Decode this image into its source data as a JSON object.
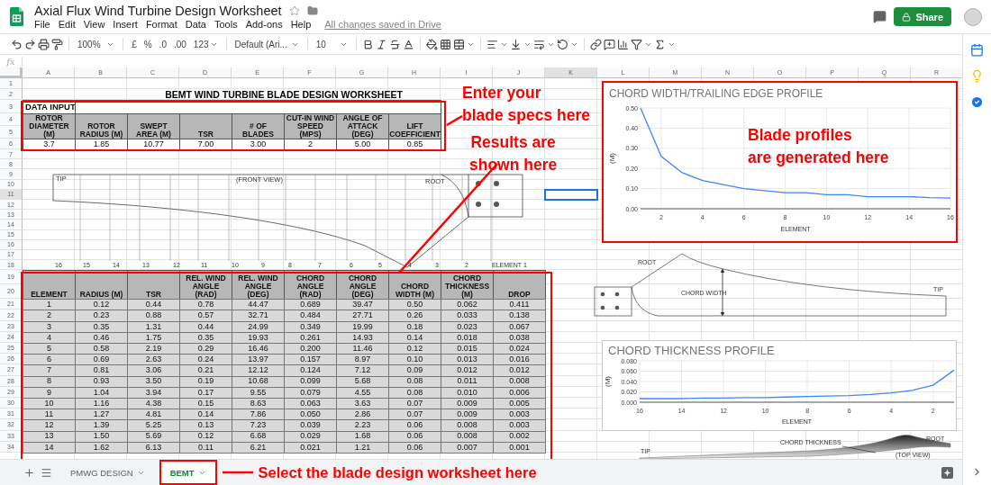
{
  "app": {
    "title": "Axial Flux Wind Turbine Design Worksheet",
    "menu": [
      "File",
      "Edit",
      "View",
      "Insert",
      "Format",
      "Data",
      "Tools",
      "Add-ons",
      "Help"
    ],
    "save_status": "All changes saved in Drive",
    "share": "Share"
  },
  "toolbar": {
    "zoom": "100%",
    "currency": "£",
    "percent": "%",
    "decrease_decimals": ".0",
    "increase_decimals": ".00",
    "number_format": "123",
    "font": "Default (Ari...",
    "font_size": "10"
  },
  "formula_bar": {
    "label": "fx"
  },
  "sheet": {
    "columns": [
      {
        "label": "A",
        "selected": false
      },
      {
        "label": "B",
        "selected": false
      },
      {
        "label": "C",
        "selected": false
      },
      {
        "label": "D",
        "selected": false
      },
      {
        "label": "E",
        "selected": false
      },
      {
        "label": "F",
        "selected": false
      },
      {
        "label": "G",
        "selected": false
      },
      {
        "label": "H",
        "selected": false
      },
      {
        "label": "I",
        "selected": false
      },
      {
        "label": "J",
        "selected": false
      },
      {
        "label": "K",
        "selected": true
      },
      {
        "label": "L",
        "selected": false
      },
      {
        "label": "M",
        "selected": false
      },
      {
        "label": "N",
        "selected": false
      },
      {
        "label": "O",
        "selected": false
      },
      {
        "label": "P",
        "selected": false
      },
      {
        "label": "Q",
        "selected": false
      },
      {
        "label": "R",
        "selected": false
      }
    ],
    "rows": [
      {
        "label": "1",
        "selected": false
      },
      {
        "label": "2",
        "selected": false
      },
      {
        "label": "3",
        "selected": false
      },
      {
        "label": "4",
        "selected": false
      },
      {
        "label": "5",
        "selected": false
      },
      {
        "label": "6",
        "selected": false
      },
      {
        "label": "7",
        "selected": false
      },
      {
        "label": "8",
        "selected": false
      },
      {
        "label": "9",
        "selected": false
      },
      {
        "label": "10",
        "selected": false
      },
      {
        "label": "11",
        "selected": true
      },
      {
        "label": "12",
        "selected": false
      },
      {
        "label": "13",
        "selected": false
      },
      {
        "label": "14",
        "selected": false
      },
      {
        "label": "15",
        "selected": false
      },
      {
        "label": "16",
        "selected": false
      },
      {
        "label": "17",
        "selected": false
      },
      {
        "label": "18",
        "selected": false
      },
      {
        "label": "19",
        "selected": false
      },
      {
        "label": "20",
        "selected": false
      },
      {
        "label": "21",
        "selected": false
      },
      {
        "label": "22",
        "selected": false
      },
      {
        "label": "23",
        "selected": false
      },
      {
        "label": "24",
        "selected": false
      },
      {
        "label": "25",
        "selected": false
      },
      {
        "label": "26",
        "selected": false
      },
      {
        "label": "27",
        "selected": false
      },
      {
        "label": "28",
        "selected": false
      },
      {
        "label": "29",
        "selected": false
      },
      {
        "label": "30",
        "selected": false
      },
      {
        "label": "31",
        "selected": false
      },
      {
        "label": "32",
        "selected": false
      },
      {
        "label": "33",
        "selected": false
      },
      {
        "label": "34",
        "selected": false
      }
    ],
    "title": "BEMT WIND TURBINE BLADE DESIGN WORKSHEET",
    "data_input": {
      "label": "DATA INPUT",
      "columns": [
        "ROTOR DIAMETER (M)",
        "ROTOR RADIUS (M)",
        "SWEPT AREA (M)",
        "TSR",
        "# OF BLADES",
        "CUT-IN WIND SPEED (MPS)",
        "ANGLE OF ATTACK (DEG)",
        "LIFT COEFFICIENT"
      ],
      "values": [
        "3.7",
        "1.85",
        "10.77",
        "7.00",
        "3.00",
        "2",
        "5.00",
        "0.85"
      ]
    },
    "results": {
      "columns": [
        "ELEMENT",
        "RADIUS (M)",
        "TSR",
        "REL. WIND ANGLE (RAD)",
        "REL. WIND ANGLE (DEG)",
        "CHORD ANGLE (RAD)",
        "CHORD ANGLE (DEG)",
        "CHORD WIDTH (M)",
        "CHORD THICKNESS (M)",
        "DROP"
      ],
      "rows": [
        [
          "1",
          "0.12",
          "0.44",
          "0.78",
          "44.47",
          "0.689",
          "39.47",
          "0.50",
          "0.062",
          "0.411"
        ],
        [
          "2",
          "0.23",
          "0.88",
          "0.57",
          "32.71",
          "0.484",
          "27.71",
          "0.26",
          "0.033",
          "0.138"
        ],
        [
          "3",
          "0.35",
          "1.31",
          "0.44",
          "24.99",
          "0.349",
          "19.99",
          "0.18",
          "0.023",
          "0.067"
        ],
        [
          "4",
          "0.46",
          "1.75",
          "0.35",
          "19.93",
          "0.261",
          "14.93",
          "0.14",
          "0.018",
          "0.038"
        ],
        [
          "5",
          "0.58",
          "2.19",
          "0.29",
          "16.46",
          "0.200",
          "11.46",
          "0.12",
          "0.015",
          "0.024"
        ],
        [
          "6",
          "0.69",
          "2.63",
          "0.24",
          "13.97",
          "0.157",
          "8.97",
          "0.10",
          "0.013",
          "0.016"
        ],
        [
          "7",
          "0.81",
          "3.06",
          "0.21",
          "12.12",
          "0.124",
          "7.12",
          "0.09",
          "0.012",
          "0.012"
        ],
        [
          "8",
          "0.93",
          "3.50",
          "0.19",
          "10.68",
          "0.099",
          "5.68",
          "0.08",
          "0.011",
          "0.008"
        ],
        [
          "9",
          "1.04",
          "3.94",
          "0.17",
          "9.55",
          "0.079",
          "4.55",
          "0.08",
          "0.010",
          "0.006"
        ],
        [
          "10",
          "1.16",
          "4.38",
          "0.15",
          "8.63",
          "0.063",
          "3.63",
          "0.07",
          "0.009",
          "0.005"
        ],
        [
          "11",
          "1.27",
          "4.81",
          "0.14",
          "7.86",
          "0.050",
          "2.86",
          "0.07",
          "0.009",
          "0.003"
        ],
        [
          "12",
          "1.39",
          "5.25",
          "0.13",
          "7.23",
          "0.039",
          "2.23",
          "0.06",
          "0.008",
          "0.003"
        ],
        [
          "13",
          "1.50",
          "5.69",
          "0.12",
          "6.68",
          "0.029",
          "1.68",
          "0.06",
          "0.008",
          "0.002"
        ],
        [
          "14",
          "1.62",
          "6.13",
          "0.11",
          "6.21",
          "0.021",
          "1.21",
          "0.06",
          "0.007",
          "0.001"
        ]
      ]
    },
    "front_view": {
      "tip": "TIP",
      "view": "(FRONT VIEW)",
      "root": "ROOT",
      "element_labels": [
        "16",
        "15",
        "14",
        "13",
        "12",
        "11",
        "10",
        "9",
        "8",
        "7",
        "6",
        "5",
        "4",
        "3",
        "2",
        "ELEMENT 1"
      ]
    },
    "side_view": {
      "root": "ROOT",
      "chord_width": "CHORD WIDTH",
      "tip": "TIP"
    },
    "top_view": {
      "chord_thickness": "CHORD THICKNESS",
      "tip": "TIP",
      "root": "ROOT",
      "view": "(TOP VIEW)"
    },
    "charts": [
      {
        "chart_data": {
          "type": "line",
          "title": "CHORD WIDTH/TRAILING EDGE PROFILE",
          "xlabel": "ELEMENT",
          "ylabel": "(M)",
          "x": [
            1,
            2,
            3,
            4,
            5,
            6,
            7,
            8,
            9,
            10,
            11,
            12,
            13,
            14,
            15,
            16
          ],
          "grid": true,
          "series": [
            {
              "color": "#4285f4",
              "values": [
                0.5,
                0.26,
                0.18,
                0.14,
                0.12,
                0.1,
                0.09,
                0.08,
                0.08,
                0.07,
                0.07,
                0.06,
                0.06,
                0.06,
                0.055,
                0.053
              ]
            }
          ],
          "xlim": [
            1,
            16
          ],
          "ylim": [
            0,
            0.5
          ],
          "xticks": [
            2,
            4,
            6,
            8,
            10,
            12,
            14,
            16
          ],
          "yticks": [
            {
              "value": 0,
              "label": "0.00"
            },
            {
              "value": 0.1,
              "label": "0.10"
            },
            {
              "value": 0.2,
              "label": "0.20"
            },
            {
              "value": 0.3,
              "label": "0.30"
            },
            {
              "value": 0.4,
              "label": "0.40"
            },
            {
              "value": 0.5,
              "label": "0.50"
            }
          ]
        }
      },
      {
        "chart_data": {
          "type": "line",
          "title": "CHORD THICKNESS PROFILE",
          "xlabel": "ELEMENT",
          "ylabel": "(M)",
          "x": [
            1,
            2,
            3,
            4,
            5,
            6,
            7,
            8,
            9,
            10,
            11,
            12,
            13,
            14,
            15,
            16
          ],
          "grid": true,
          "series": [
            {
              "color": "#4285f4",
              "values": [
                0.062,
                0.033,
                0.023,
                0.018,
                0.015,
                0.013,
                0.012,
                0.011,
                0.01,
                0.009,
                0.009,
                0.008,
                0.008,
                0.007,
                0.007,
                0.007
              ]
            }
          ],
          "xlim": [
            16,
            1
          ],
          "ylim": [
            0,
            0.08
          ],
          "xticks": [
            16,
            14,
            12,
            10,
            8,
            6,
            4,
            2
          ],
          "yticks": [
            {
              "value": 0,
              "label": "0.000"
            },
            {
              "value": 0.02,
              "label": "0.020"
            },
            {
              "value": 0.04,
              "label": "0.040"
            },
            {
              "value": 0.06,
              "label": "0.060"
            },
            {
              "value": 0.08,
              "label": "0.080"
            }
          ]
        }
      }
    ]
  },
  "sheet_tabs": [
    {
      "label": "PMWG DESIGN",
      "selected": false
    },
    {
      "label": "BEMT",
      "selected": true
    }
  ],
  "annotations": [
    {
      "lines": [
        "Enter your",
        "blade specs here"
      ]
    },
    {
      "lines": [
        "Results are",
        "shown here"
      ]
    },
    {
      "lines": [
        "Blade profiles",
        "are generated here"
      ]
    },
    {
      "lines": [
        "Select the blade design worksheet here"
      ]
    }
  ]
}
